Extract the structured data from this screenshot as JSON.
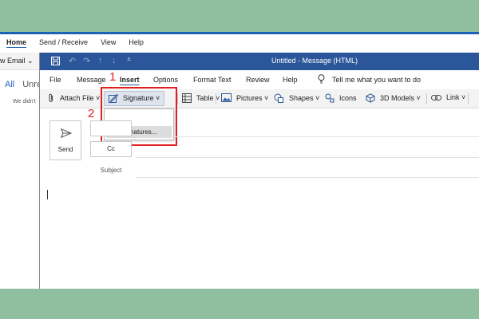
{
  "background_window": {
    "tabs": [
      "Home",
      "Send / Receive",
      "View",
      "Help"
    ],
    "new_email_label": "w Email  ⌄",
    "folder_tabs": [
      "All",
      "Unre"
    ],
    "empty_message": "We didn't"
  },
  "compose": {
    "title": "Untitled  -  Message (HTML)",
    "menu": {
      "file": "File",
      "message": "Message",
      "insert": "Insert",
      "options": "Options",
      "format_text": "Format Text",
      "review": "Review",
      "help": "Help",
      "tell_me": "Tell me what you want to do"
    },
    "ribbon": {
      "attach_file": "Attach File ˅",
      "signature": "Signature ˅",
      "table": "Table ˅",
      "pictures": "Pictures ˅",
      "shapes": "Shapes ˅",
      "icons": "Icons",
      "models_3d": "3D Models ˅",
      "link": "Link ˅"
    },
    "dropdown": {
      "signatures_item": "Signatures..."
    },
    "send_label": "Send",
    "cc_label": "Cc",
    "subject_label": "Subject"
  },
  "annotations": {
    "step1": "1",
    "step2": "2"
  },
  "colors": {
    "titlebar": "#2b579a",
    "annotation": "#e02020",
    "background": "#8fbf9f"
  }
}
